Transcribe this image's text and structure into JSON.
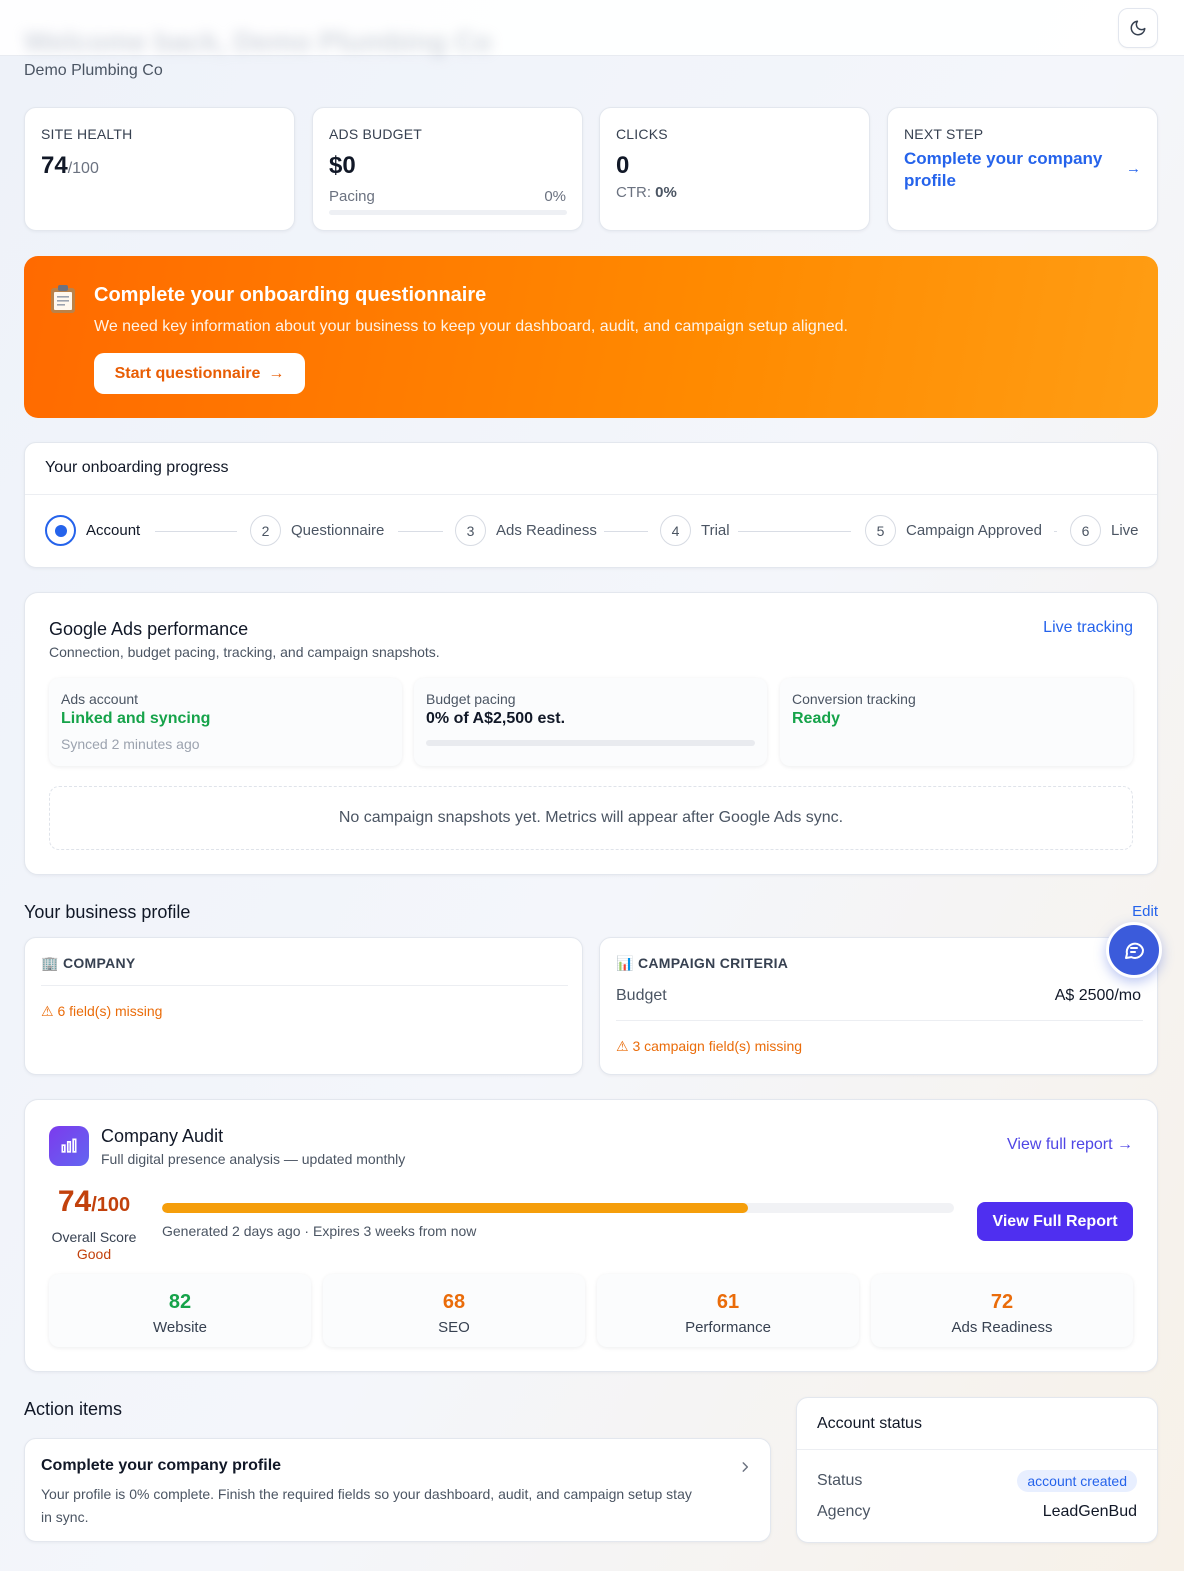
{
  "header": {
    "blurred_title": "Welcome back, Demo Plumbing Co",
    "subtitle": "Demo Plumbing Co",
    "theme_toggle_icon": "moon-icon"
  },
  "stats": {
    "site_health": {
      "label": "SITE HEALTH",
      "value": "74",
      "suffix": "/100"
    },
    "ads_budget": {
      "label": "ADS BUDGET",
      "value": "$0",
      "pacing_label": "Pacing",
      "pacing_value": "0%",
      "pacing_fraction": 0
    },
    "clicks": {
      "label": "CLICKS",
      "value": "0",
      "ctr_label": "CTR:",
      "ctr_value": "0%"
    },
    "next_step": {
      "label": "NEXT STEP",
      "text": "Complete your company profile",
      "arrow": "→"
    }
  },
  "banner": {
    "icon": "clipboard-icon",
    "title": "Complete your onboarding questionnaire",
    "description": "We need key information about your business to keep your dashboard, audit, and campaign setup aligned.",
    "button_label": "Start questionnaire",
    "button_arrow": "→"
  },
  "onboarding": {
    "title": "Your onboarding progress",
    "steps": [
      {
        "number": "",
        "label": "Account",
        "active": true
      },
      {
        "number": "2",
        "label": "Questionnaire"
      },
      {
        "number": "3",
        "label": "Ads Readiness"
      },
      {
        "number": "4",
        "label": "Trial"
      },
      {
        "number": "5",
        "label": "Campaign Approved"
      },
      {
        "number": "6",
        "label": "Live"
      }
    ]
  },
  "ads": {
    "title": "Google Ads performance",
    "subtitle": "Connection, budget pacing, tracking, and campaign snapshots.",
    "live_link": "Live tracking",
    "account": {
      "label": "Ads account",
      "value": "Linked and syncing",
      "meta": "Synced 2 minutes ago"
    },
    "pacing": {
      "label": "Budget pacing",
      "value": "0% of A$2,500 est.",
      "fraction": 0
    },
    "tracking": {
      "label": "Conversion tracking",
      "value": "Ready"
    },
    "empty_text": "No campaign snapshots yet. Metrics will appear after Google Ads sync."
  },
  "profile": {
    "heading": "Your business profile",
    "edit_label": "Edit",
    "company": {
      "icon": "🏢",
      "title": "COMPANY",
      "warning": "⚠ 6 field(s) missing"
    },
    "criteria": {
      "icon": "📊",
      "title": "CAMPAIGN CRITERIA",
      "budget_label": "Budget",
      "budget_value": "A$ 2500/mo",
      "warning": "⚠ 3 campaign field(s) missing"
    }
  },
  "audit": {
    "icon": "bar-chart-icon",
    "title": "Company Audit",
    "subtitle": "Full digital presence analysis — updated monthly",
    "view_link": "View full report →",
    "score": "74",
    "score_suffix": "/100",
    "score_label": "Overall Score",
    "score_grade": "Good",
    "score_fraction": 0.74,
    "meta": "Generated 2 days ago · Expires 3 weeks from now",
    "button_label": "View Full Report",
    "categories": [
      {
        "value": "82",
        "name": "Website",
        "color": "#16a34a"
      },
      {
        "value": "68",
        "name": "SEO",
        "color": "#ea6c0a"
      },
      {
        "value": "61",
        "name": "Performance",
        "color": "#ea6c0a"
      },
      {
        "value": "72",
        "name": "Ads Readiness",
        "color": "#ea6c0a"
      }
    ]
  },
  "actions": {
    "heading": "Action items",
    "item": {
      "title": "Complete your company profile",
      "description": "Your profile is 0% complete. Finish the required fields so your dashboard, audit, and campaign setup stay in sync.",
      "chevron_icon": "chevron-right-icon"
    }
  },
  "account_status": {
    "title": "Account status",
    "status_label": "Status",
    "status_value": "account created",
    "agency_label": "Agency",
    "agency_value": "LeadGenBud"
  },
  "chat": {
    "icon": "chat-icon"
  },
  "colors": {
    "accent_blue": "#2563eb",
    "accent_purple": "#4f46e5",
    "banner_orange": "#ff7a00",
    "success_green": "#16a34a",
    "warning_orange": "#ea6c0a"
  }
}
